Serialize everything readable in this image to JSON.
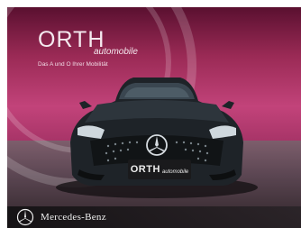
{
  "dealer_logo": {
    "brand": "ORTH",
    "sub": "automobile",
    "tagline": "Das A und O Ihrer Mobilität"
  },
  "plate": {
    "brand": "ORTH",
    "sub": "automobile"
  },
  "footer": {
    "brand_label": "Mercedes-Benz",
    "logo_icon": "mercedes-star-icon"
  },
  "colors": {
    "backdrop": "#c2437a",
    "car_body": "#1e2328",
    "footer_bg": "#1a171a"
  }
}
